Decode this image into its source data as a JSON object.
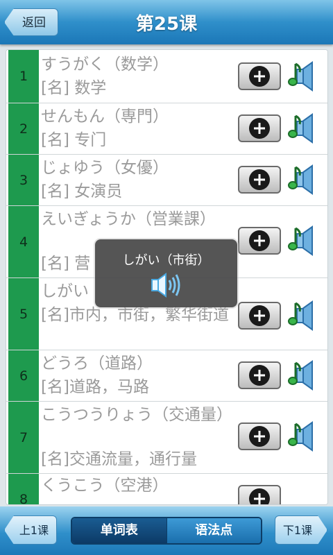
{
  "header": {
    "back_label": "返回",
    "title": "第25课"
  },
  "words": [
    {
      "num": "1",
      "word": "すうがく（数学）",
      "meaning": "[名] 数学"
    },
    {
      "num": "2",
      "word": "せんもん（専門）",
      "meaning": "[名] 专门"
    },
    {
      "num": "3",
      "word": "じょゆう（女優）",
      "meaning": "[名] 女演员"
    },
    {
      "num": "4",
      "word": "えいぎょうか（営業課）",
      "meaning": "[名] 营"
    },
    {
      "num": "5",
      "word": "しがい",
      "meaning": "[名]市内，市街，繁华街道"
    },
    {
      "num": "6",
      "word": "どうろ（道路）",
      "meaning": "[名]道路，马路"
    },
    {
      "num": "7",
      "word": "こうつうりょう（交通量）",
      "meaning": "[名]交通流量，通行量"
    },
    {
      "num": "8",
      "word": "くうこう（空港）",
      "meaning": ""
    }
  ],
  "popup": {
    "text": "しがい（市街）"
  },
  "footer": {
    "prev_label": "上1课",
    "tab_words": "单词表",
    "tab_grammar": "语法点",
    "next_label": "下1课"
  },
  "colors": {
    "accent": "#2f8fca",
    "number_cell": "#1e9a4e",
    "text_gray": "#9a9a9a"
  }
}
